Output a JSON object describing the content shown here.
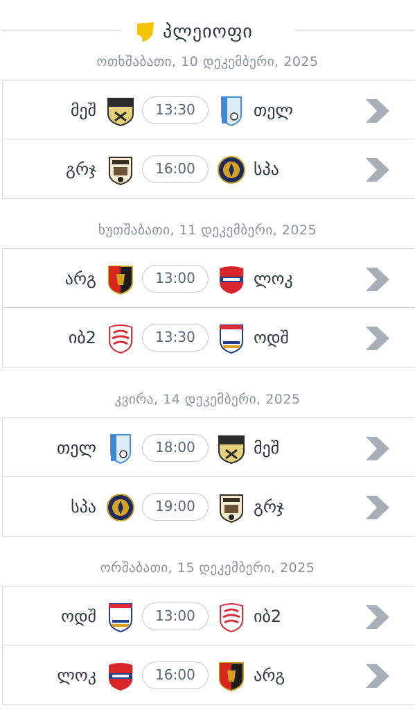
{
  "header": {
    "title": "პლეიოფი",
    "icon": "league-icon",
    "accent": "#f5c400"
  },
  "days": [
    {
      "date": "ოთხშაბათი, 10 დეკემბერი, 2025",
      "matches": [
        {
          "home": "მეშ",
          "away": "თელ",
          "time": "13:30",
          "home_logo": "shield-mesh-crest",
          "away_logo": "shield-tel-crest"
        },
        {
          "home": "გრჯ",
          "away": "სპა",
          "time": "16:00",
          "home_logo": "shield-grj-crest",
          "away_logo": "round-spa-crest"
        }
      ]
    },
    {
      "date": "ხუთშაბათი, 11 დეკემბერი, 2025",
      "matches": [
        {
          "home": "არგ",
          "away": "ლოკ",
          "time": "13:00",
          "home_logo": "shield-arg-crest",
          "away_logo": "shield-lok-crest"
        },
        {
          "home": "იბ2",
          "away": "ოდშ",
          "time": "13:30",
          "home_logo": "shield-ib2-crest",
          "away_logo": "shield-odsh-crest"
        }
      ]
    },
    {
      "date": "კვირა, 14 დეკემბერი, 2025",
      "matches": [
        {
          "home": "თელ",
          "away": "მეშ",
          "time": "18:00",
          "home_logo": "shield-tel-crest",
          "away_logo": "shield-mesh-crest"
        },
        {
          "home": "სპა",
          "away": "გრჯ",
          "time": "19:00",
          "home_logo": "round-spa-crest",
          "away_logo": "shield-grj-crest"
        }
      ]
    },
    {
      "date": "ორშაბათი, 15 დეკემბერი, 2025",
      "matches": [
        {
          "home": "ოდშ",
          "away": "იბ2",
          "time": "13:00",
          "home_logo": "shield-odsh-crest",
          "away_logo": "shield-ib2-crest"
        },
        {
          "home": "ლოკ",
          "away": "არგ",
          "time": "16:00",
          "home_logo": "shield-lok-crest",
          "away_logo": "shield-arg-crest"
        }
      ]
    }
  ],
  "colors": {
    "chevron": "#a9afb8",
    "divider": "#d7dade",
    "date_text": "#8b9199"
  }
}
